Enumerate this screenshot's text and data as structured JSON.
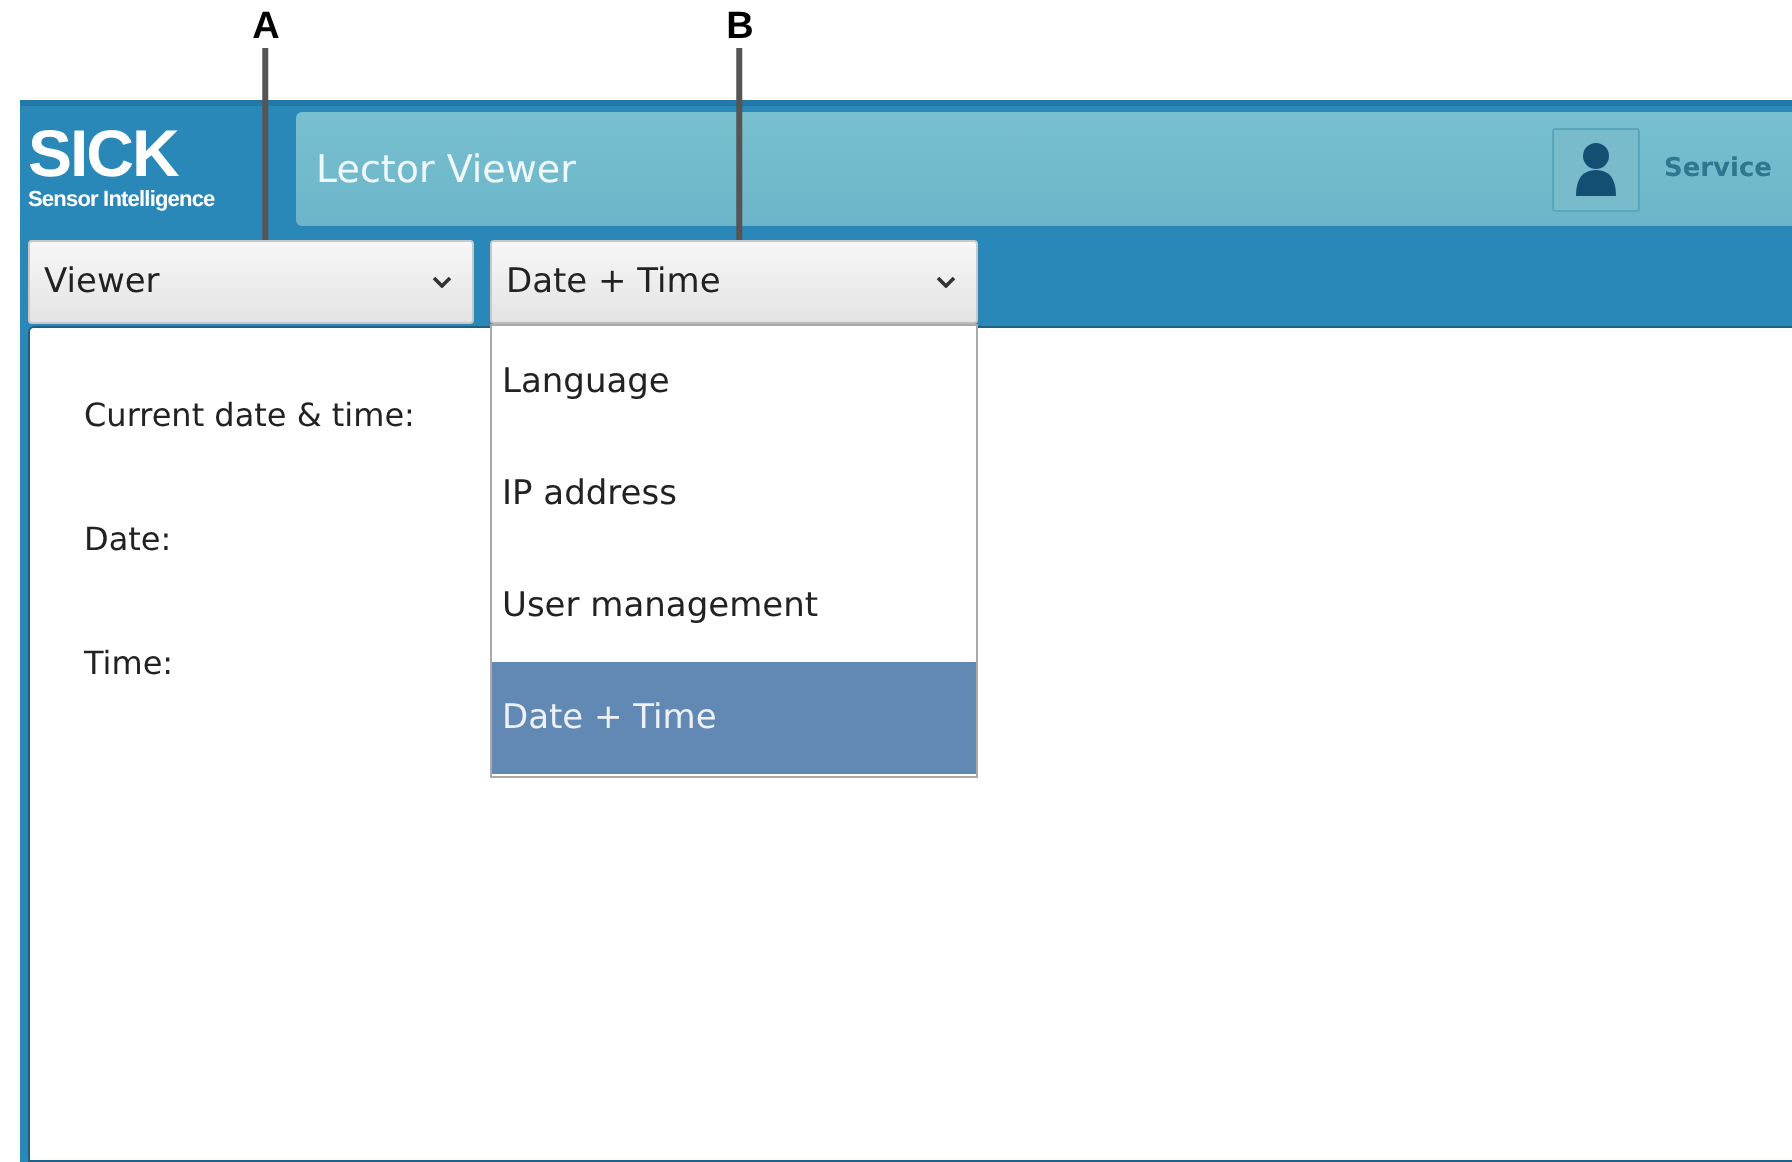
{
  "callouts": [
    {
      "label": "A"
    },
    {
      "label": "B"
    }
  ],
  "header": {
    "logo": "SICK",
    "tagline": "Sensor Intelligence",
    "title": "Lector Viewer",
    "user": "Service"
  },
  "selects": [
    {
      "value": "Viewer",
      "expanded": false
    },
    {
      "value": "Date + Time",
      "expanded": true
    }
  ],
  "menu": [
    {
      "label": "Language",
      "selected": false
    },
    {
      "label": "IP address",
      "selected": false
    },
    {
      "label": "User management",
      "selected": false
    },
    {
      "label": "Date + Time",
      "selected": true
    }
  ],
  "form": {
    "fields": [
      {
        "label": "Current date & time:"
      },
      {
        "label": "Date:"
      },
      {
        "label": "Time:"
      }
    ]
  }
}
